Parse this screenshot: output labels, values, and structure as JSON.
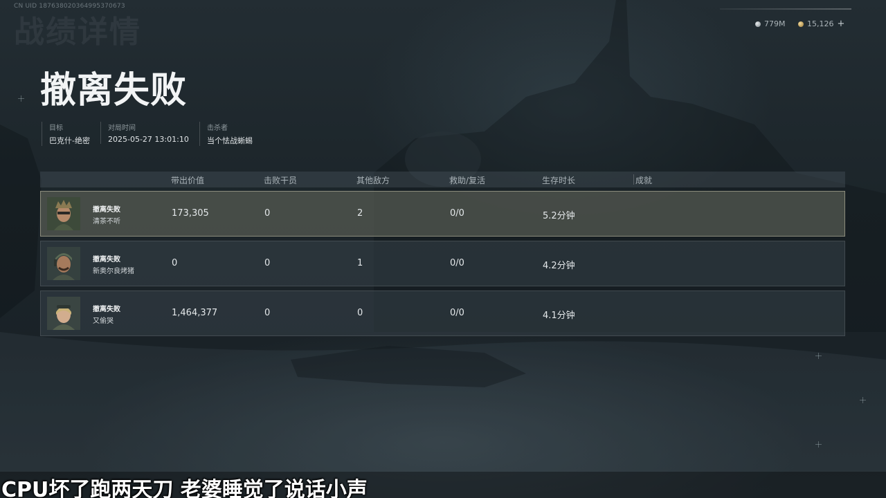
{
  "header": {
    "uid": "CN UID 187638020364995370673",
    "watermark": "战绩详情",
    "title": "撤离失败"
  },
  "currency": [
    {
      "icon": "silver-coin-icon",
      "value": "779M"
    },
    {
      "icon": "gold-coin-icon",
      "value": "15,126"
    }
  ],
  "meta": [
    {
      "label": "目标",
      "value": "巴克什-绝密"
    },
    {
      "label": "对局时间",
      "value": "2025-05-27 13:01:10"
    },
    {
      "label": "击杀者",
      "value": "当个怯战蜥蜴"
    }
  ],
  "table": {
    "columns": [
      "带出价值",
      "击败干员",
      "其他敌方",
      "救助/复活",
      "生存时长",
      "成就"
    ],
    "rows": [
      {
        "status": "撤离失败",
        "name": "清茶不听",
        "value": "173,305",
        "kills": "0",
        "other": "2",
        "assist": "0/0",
        "survival": "5.2分钟",
        "achievement": "",
        "highlighted": true
      },
      {
        "status": "撤离失败",
        "name": "新奥尔良烤猪",
        "value": "0",
        "kills": "0",
        "other": "1",
        "assist": "0/0",
        "survival": "4.2分钟",
        "achievement": "",
        "highlighted": false
      },
      {
        "status": "撤离失败",
        "name": "又偷哭",
        "value": "1,464,377",
        "kills": "0",
        "other": "0",
        "assist": "0/0",
        "survival": "4.1分钟",
        "achievement": "",
        "highlighted": false
      }
    ]
  },
  "subtitle": "CPU坏了跑两天刀 老婆睡觉了说话小声",
  "colors": {
    "highlight_border": "#d2cdb4",
    "row_bg": "#374148",
    "text_primary": "#f2f4f5"
  }
}
